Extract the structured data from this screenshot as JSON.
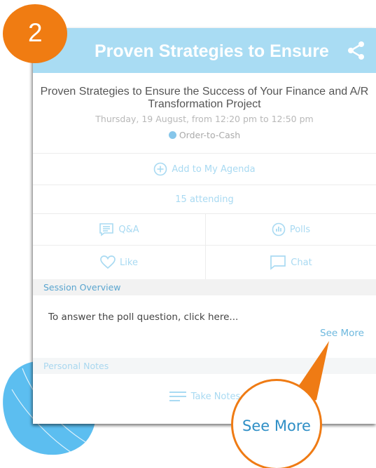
{
  "step": {
    "number": "2"
  },
  "app_bar": {
    "title": "Proven Strategies to Ensure t...",
    "share_icon": "share-icon",
    "background": "#a9dcf3"
  },
  "session": {
    "title": "Proven Strategies to Ensure the Success of Your Finance and A/R Transformation Project",
    "time": "Thursday, 19 August, from 12:20 pm to 12:50 pm",
    "track": "Order-to-Cash",
    "track_color": "#86c6ea"
  },
  "actions": {
    "add_agenda": "Add to My Agenda",
    "attending": "15 attending",
    "qa": "Q&A",
    "polls": "Polls",
    "like": "Like",
    "chat": "Chat"
  },
  "overview": {
    "header": "Session Overview",
    "text": "To answer the poll question, click here...",
    "see_more": "See More"
  },
  "notes": {
    "header": "Personal Notes",
    "take_notes": "Take Notes"
  },
  "callout": {
    "label": "See More",
    "accent": "#ef7b14"
  }
}
